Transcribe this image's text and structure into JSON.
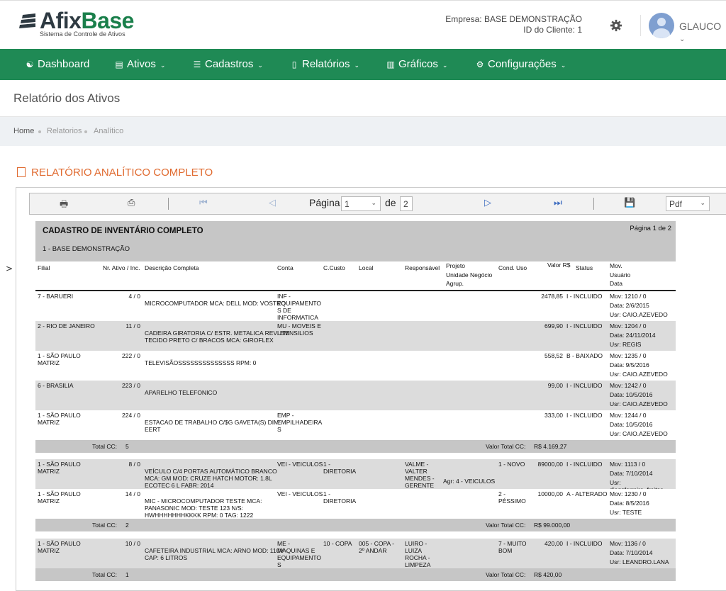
{
  "header": {
    "logo": {
      "brand_a": "Afix",
      "brand_b": "Base",
      "tagline": "Sistema de Controle de Ativos"
    },
    "empresa_line": "Empresa: BASE DEMONSTRAÇÃO",
    "cliente_line": "ID do Cliente: 1",
    "user_name": "GLAUCO",
    "settings_icon": "gear-icon"
  },
  "nav": [
    {
      "label": "Dashboard",
      "icon": "dashboard-icon",
      "glyph": "☯",
      "caret": ""
    },
    {
      "label": "Ativos",
      "icon": "ativos-icon",
      "glyph": "▤",
      "caret": "⌄"
    },
    {
      "label": "Cadastros",
      "icon": "list-icon",
      "glyph": "☰",
      "caret": "⌄"
    },
    {
      "label": "Relatórios",
      "icon": "file-icon",
      "glyph": "▯",
      "caret": "⌄"
    },
    {
      "label": "Gráficos",
      "icon": "bar-chart-icon",
      "glyph": "▥",
      "caret": "⌄"
    },
    {
      "label": "Configurações",
      "icon": "sliders-icon",
      "glyph": "⚙",
      "caret": "⌄"
    }
  ],
  "page_title": "Relatório dos Ativos",
  "breadcrumb": [
    "Home",
    "Relatorios",
    "Analítico"
  ],
  "section_title": "RELATÓRIO ANALÍTICO COMPLETO",
  "toolbar": {
    "page_label": "Página",
    "page_value": "1",
    "of_label": "de",
    "total_pages": "2",
    "format_value": "Pdf"
  },
  "report": {
    "title": "CADASTRO DE INVENTÁRIO COMPLETO",
    "subtitle": "1 - BASE DEMONSTRAÇÃO",
    "page_info": "Página 1 de 2",
    "columns": {
      "filial": "Filial",
      "nr": "Nr. Ativo / Inc.",
      "desc": "Descrição Completa",
      "conta": "Conta",
      "ccusto": "C.Custo",
      "local": "Local",
      "resp": "Responsável",
      "projeto": "Projeto\nUnidade Negócio\nAgrup.",
      "cond": "Cond. Uso",
      "valor": "Valor R$",
      "status": "Status",
      "mov": "Mov.\nUsuário\nData"
    },
    "total_cc_label": "Total CC:",
    "valor_total_label": "Valor Total CC:",
    "groups": [
      {
        "rows": [
          {
            "filial": "7 - BARUERI",
            "nr": "4 / 0",
            "desc": "MICROCOMPUTADOR MCA: DELL MOD: VOSTRO",
            "conta": "INF -\nEQUIPAMENTO\nS DE\nINFORMATICA",
            "ccusto": "",
            "local": "",
            "resp": "",
            "projeto": "",
            "cond": "",
            "valor": "2478,85",
            "status": "I - INCLUIDO",
            "mov": "Mov: 1210 / 0",
            "data": "Data: 2/6/2015",
            "usr": "Usr: CAIO.AZEVEDO"
          },
          {
            "filial": "2 - RIO DE JANEIRO",
            "nr": "11 / 0",
            "desc": "CADEIRA GIRATORIA C/ ESTR. METALICA REV. EM\nTECIDO PRETO C/ BRACOS MCA: GIROFLEX",
            "conta": "MU - MOVEIS E\nUTENSILIOS",
            "ccusto": "",
            "local": "",
            "resp": "",
            "projeto": "",
            "cond": "",
            "valor": "699,90",
            "status": "I - INCLUIDO",
            "mov": "Mov: 1204 / 0",
            "data": "Data: 24/11/2014",
            "usr": "Usr: REGIS"
          },
          {
            "filial": "1 - SÃO PAULO\nMATRIZ",
            "nr": "222 / 0",
            "desc": "TELEVISÃOSSSSSSSSSSSSSS RPM: 0",
            "conta": "",
            "ccusto": "",
            "local": "",
            "resp": "",
            "projeto": "",
            "cond": "",
            "valor": "558,52",
            "status": "B - BAIXADO",
            "mov": "Mov: 1235 / 0",
            "data": "Data: 9/5/2016",
            "usr": "Usr: CAIO.AZEVEDO"
          },
          {
            "filial": "6 - BRASILIA",
            "nr": "223 / 0",
            "desc": "APARELHO TELEFONICO",
            "conta": "",
            "ccusto": "",
            "local": "",
            "resp": "",
            "projeto": "",
            "cond": "",
            "valor": "99,00",
            "status": "I - INCLUIDO",
            "mov": "Mov: 1242 / 0",
            "data": "Data: 10/5/2016",
            "usr": "Usr: CAIO.AZEVEDO"
          },
          {
            "filial": "1 - SÃO PAULO\nMATRIZ",
            "nr": "224 / 0",
            "desc": "ESTACAO DE TRABALHO C/$G GAVETA(S) DIM:\nEERT",
            "conta": "EMP -\nEMPILHADEIRA\nS",
            "ccusto": "",
            "local": "",
            "resp": "",
            "projeto": "",
            "cond": "",
            "valor": "333,00",
            "status": "I - INCLUIDO",
            "mov": "Mov: 1244 / 0",
            "data": "Data: 10/5/2016",
            "usr": "Usr: CAIO.AZEVEDO"
          }
        ],
        "total_count": "5",
        "total_value": "R$ 4.169,27"
      },
      {
        "rows": [
          {
            "filial": "1 - SÃO PAULO\nMATRIZ",
            "nr": "8 / 0",
            "desc": "VEÍCULO C/4 PORTAS AUTOMÁTICO BRANCO\nMCA: GM MOD: CRUZE HATCH MOTOR: 1.8L\nECOTEC 6 L FABR: 2014",
            "conta": "VEI - VEICULOS",
            "ccusto": "1 -\nDIRETORIA",
            "local": "",
            "resp": "VALME -\nVALTER\nMENDES -\nGERENTE",
            "projeto": "Agr: 4 - VEICULOS",
            "cond": "1 - NOVO",
            "valor": "89000,00",
            "status": "I - INCLUIDO",
            "mov": "Mov: 1113 / 0",
            "data": "Data: 7/10/2014",
            "usr": "Usr: diegoferreira_freitas"
          },
          {
            "filial": "1 - SÃO PAULO\nMATRIZ",
            "nr": "14 / 0",
            "desc": "MIC - MICROCOMPUTADOR TESTE MCA:\nPANASONIC MOD: TESTE 123 N/S:\nHWHHHHHHHKKKK RPM: 0 TAG: 1222",
            "conta": "VEI - VEICULOS",
            "ccusto": "1 -\nDIRETORIA",
            "local": "",
            "resp": "",
            "projeto": "",
            "cond": "2 -\nPÉSSIMO",
            "valor": "10000,00",
            "status": "A - ALTERADO",
            "mov": "Mov: 1230 / 0",
            "data": "Data: 8/5/2016",
            "usr": "Usr: TESTE"
          }
        ],
        "total_count": "2",
        "total_value": "R$ 99.000,00"
      },
      {
        "rows": [
          {
            "filial": "1 - SÃO PAULO\nMATRIZ",
            "nr": "10 / 0",
            "desc": "CAFETEIRA INDUSTRIAL MCA: ARNO MOD: 110V\nCAP: 6 LITROS",
            "conta": "ME -\nMAQUINAS E\nEQUIPAMENTO\nS",
            "ccusto": "10 - COPA",
            "local": "005 - COPA -\n2º ANDAR",
            "resp": "LUIRO -\nLUIZA\nROCHA -\nLIMPEZA",
            "projeto": "",
            "cond": "7 - MUITO\nBOM",
            "valor": "420,00",
            "status": "I - INCLUIDO",
            "mov": "Mov: 1136 / 0",
            "data": "Data: 7/10/2014",
            "usr": "Usr: LEANDRO.LANA"
          }
        ],
        "total_count": "1",
        "total_value": "R$ 420,00"
      }
    ]
  }
}
